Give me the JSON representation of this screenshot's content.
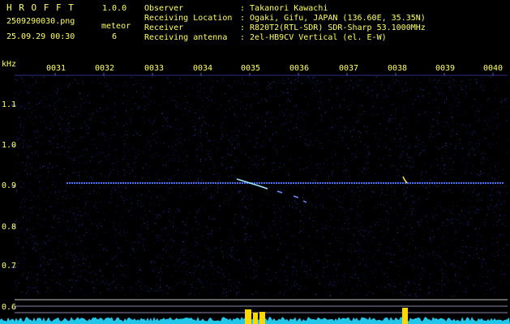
{
  "header": {
    "app_title": "H R O F F T",
    "version": "1.0.0",
    "filename": "2509290030.png",
    "datetime": "25.09.29 00:30",
    "meteor_label": "meteor",
    "meteor_count": "6",
    "info_labels": [
      "Observer",
      "Receiving Location",
      "Receiver",
      "Receiving antenna"
    ],
    "info_values": [
      ": Takanori Kawachi",
      ": Ogaki, Gifu, JAPAN (136.60E, 35.35N)",
      ": R820T2(RTL-SDR) SDR-Sharp 53.1000MHz",
      ": 2el-HB9CV Vertical (el. E-W)"
    ]
  },
  "spectrogram": {
    "y_unit": "kHz",
    "time_labels": [
      "0031",
      "0032",
      "0033",
      "0034",
      "0035",
      "0036",
      "0037",
      "0038",
      "0039",
      "0040"
    ],
    "freq_labels": [
      "1.1",
      "1.0",
      "0.9",
      "0.8",
      "0.7",
      "0.6"
    ],
    "colors": {
      "text": "#ffff66",
      "grid": "#5560c0",
      "carrier": "#4a6fff",
      "echo": "#9fe8ff",
      "amp": "#22c6e8",
      "peak": "#ffd800"
    }
  }
}
